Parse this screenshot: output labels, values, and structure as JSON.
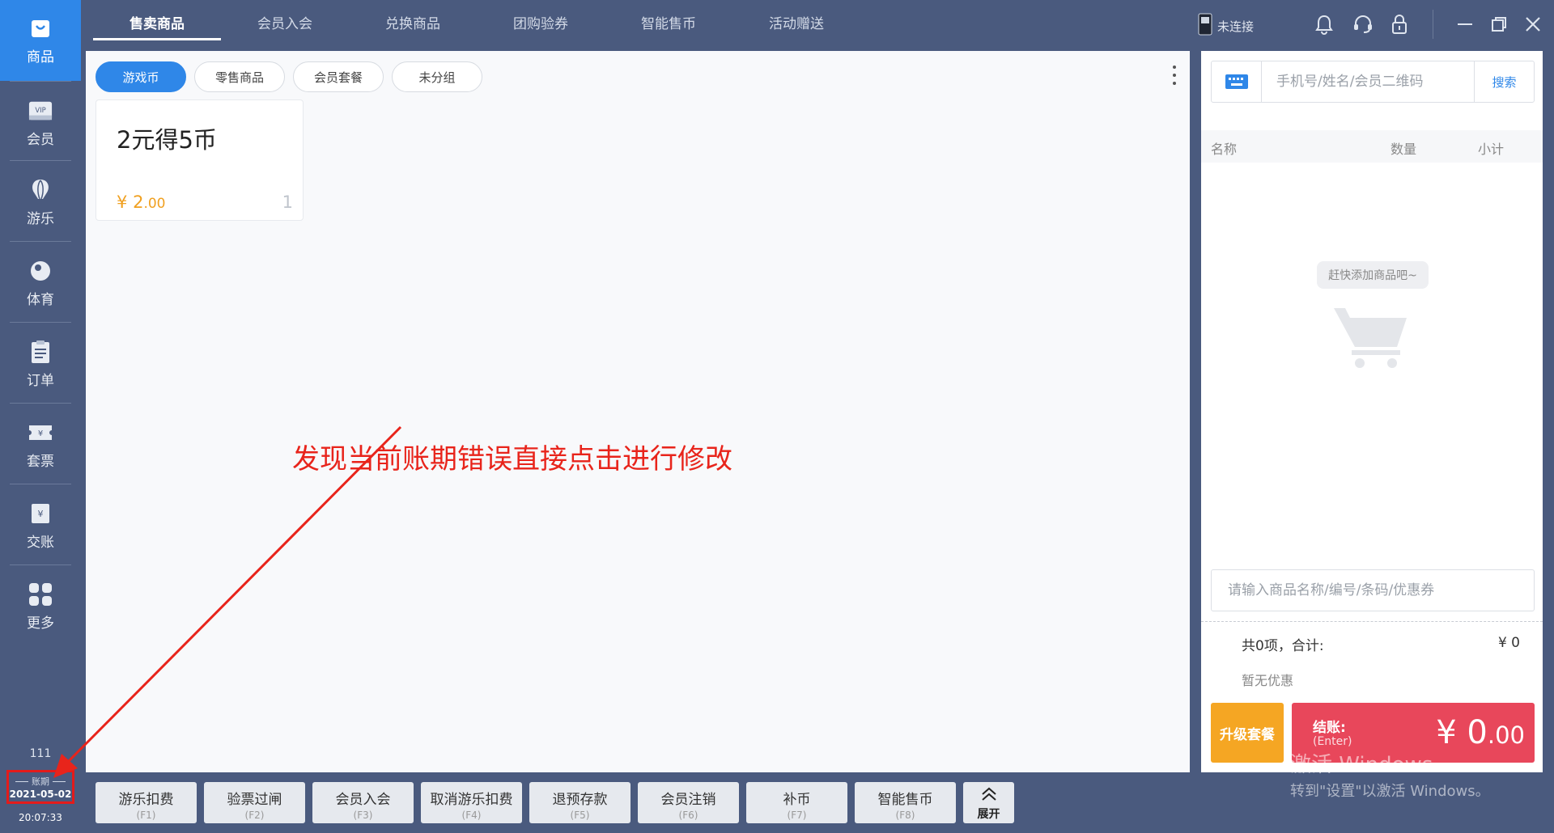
{
  "sidebar": {
    "items": [
      {
        "label": "商品",
        "icon": "bag-icon",
        "active": true
      },
      {
        "label": "会员",
        "icon": "vip-card-icon"
      },
      {
        "label": "游乐",
        "icon": "balloon-icon"
      },
      {
        "label": "体育",
        "icon": "billiard-ball-icon"
      },
      {
        "label": "订单",
        "icon": "clipboard-icon"
      },
      {
        "label": "套票",
        "icon": "ticket-icon"
      },
      {
        "label": "交账",
        "icon": "cash-icon"
      },
      {
        "label": "更多",
        "icon": "grid-icon"
      }
    ],
    "footer_num": "111",
    "period_label": "账期",
    "period_date": "2021-05-02",
    "time": "20:07:33"
  },
  "tabs": [
    {
      "label": "售卖商品",
      "active": true
    },
    {
      "label": "会员入会"
    },
    {
      "label": "兑换商品"
    },
    {
      "label": "团购验券"
    },
    {
      "label": "智能售币"
    },
    {
      "label": "活动赠送"
    }
  ],
  "topright": {
    "connection": "未连接"
  },
  "main": {
    "chips": [
      {
        "label": "游戏币",
        "active": true
      },
      {
        "label": "零售商品"
      },
      {
        "label": "会员套餐"
      },
      {
        "label": "未分组"
      }
    ],
    "products": [
      {
        "name": "2元得5币",
        "price_symbol": "¥",
        "price_int": "2",
        "price_dec": ".00",
        "count": "1"
      }
    ],
    "annotation": "发现当前账期错误直接点击进行修改"
  },
  "cart": {
    "search_placeholder": "手机号/姓名/会员二维码",
    "search_button": "搜索",
    "col_name": "名称",
    "col_qty": "数量",
    "col_subtotal": "小计",
    "empty_text": "赶快添加商品吧~",
    "product_placeholder": "请输入商品名称/编号/条码/优惠券",
    "total_label": "共0项，合计:",
    "total_value": "¥ 0",
    "promo": "暂无优惠",
    "upgrade": "升级套餐",
    "checkout_label": "结账:",
    "checkout_key": "(Enter)",
    "checkout_symbol": "¥ ",
    "checkout_int": "0",
    "checkout_dec": ".00"
  },
  "watermark": {
    "line1": "激活 Windows",
    "line2": "转到\"设置\"以激活 Windows。"
  },
  "bottom_buttons": [
    {
      "label": "游乐扣费",
      "key": "(F1)"
    },
    {
      "label": "验票过闸",
      "key": "(F2)"
    },
    {
      "label": "会员入会",
      "key": "(F3)"
    },
    {
      "label": "取消游乐扣费",
      "key": "(F4)"
    },
    {
      "label": "退预存款",
      "key": "(F5)"
    },
    {
      "label": "会员注销",
      "key": "(F6)"
    },
    {
      "label": "补币",
      "key": "(F7)"
    },
    {
      "label": "智能售币",
      "key": "(F8)"
    }
  ],
  "expand_label": "展开",
  "colors": {
    "accent": "#2f87e8",
    "sidebar": "#4a5a7e",
    "price": "#f0a020",
    "checkout": "#e8475b",
    "upgrade": "#f5a623",
    "annotation": "#e8241b"
  }
}
